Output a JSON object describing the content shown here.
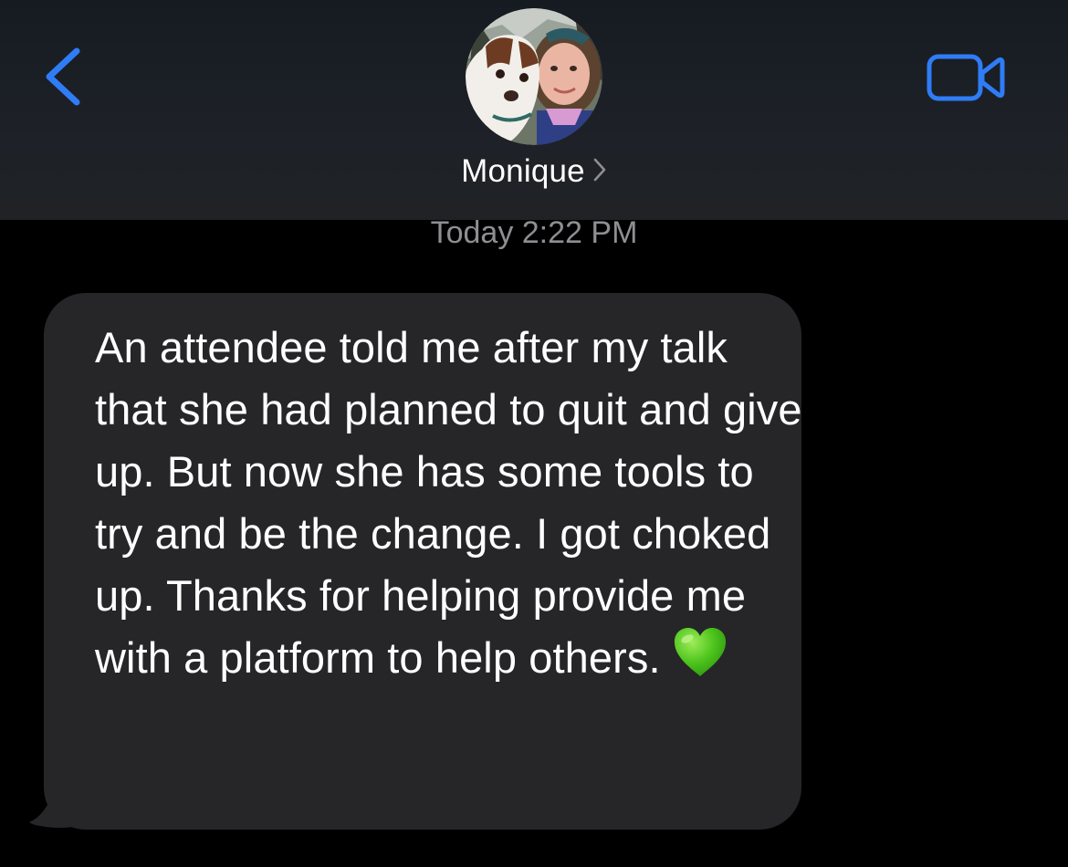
{
  "header": {
    "back_icon": "chevron-left-icon",
    "contact_name": "Monique",
    "name_chevron_icon": "chevron-right-icon",
    "avatar_icon": "contact-photo-avatar",
    "video_icon": "video-camera-icon",
    "accent_color": "#2f7cf6"
  },
  "conversation": {
    "timestamp": "Today 2:22 PM",
    "messages": [
      {
        "direction": "incoming",
        "text": "An attendee told me after my talk that she had planned to quit and give up. But now she has some tools to try and be the change. I got choked up. Thanks for helping provide me with a platform to help others.",
        "emoji_icon": "green-heart-emoji",
        "bubble_color": "#262629"
      }
    ]
  }
}
